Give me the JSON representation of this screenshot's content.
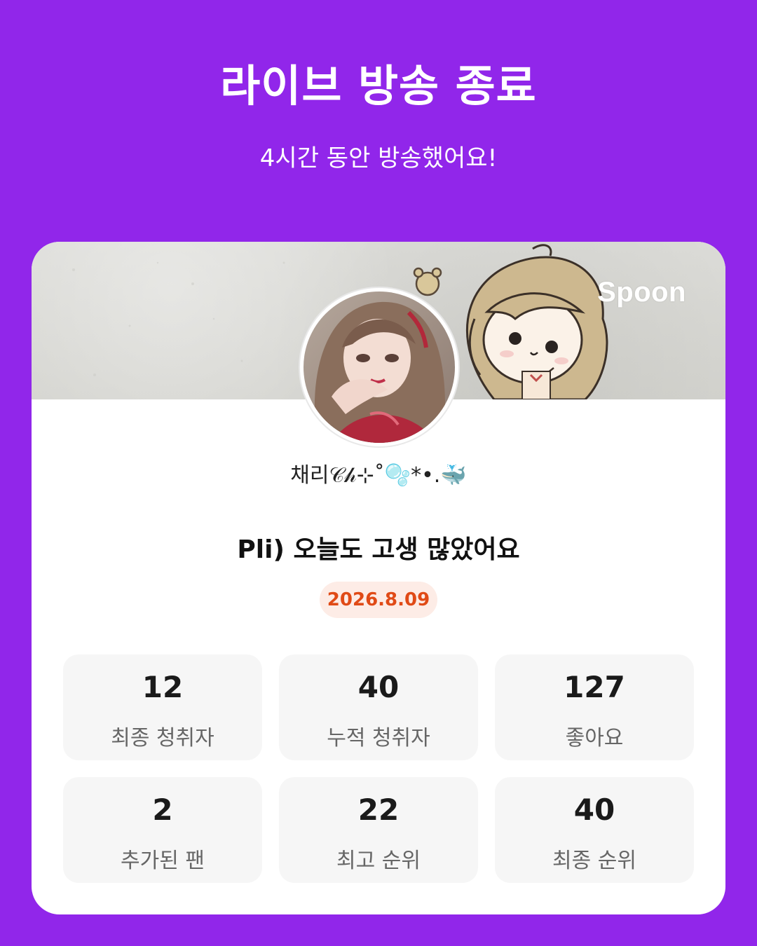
{
  "header": {
    "title": "라이브 방송 종료",
    "subtitle": "4시간 동안 방송했어요!"
  },
  "card": {
    "brand": "Spoon",
    "username": "채리𝒞𝒽⊹˚🫧*•.🐳",
    "broadcast_title": "Pli) 오늘도 고생 많았어요",
    "date": "2026.8.09"
  },
  "stats": [
    {
      "value": "12",
      "label": "최종 청취자"
    },
    {
      "value": "40",
      "label": "누적 청취자"
    },
    {
      "value": "127",
      "label": "좋아요"
    },
    {
      "value": "2",
      "label": "추가된 팬"
    },
    {
      "value": "22",
      "label": "최고 순위"
    },
    {
      "value": "40",
      "label": "최종 순위"
    }
  ],
  "colors": {
    "background": "#9126ea",
    "card": "#ffffff",
    "date_badge_bg": "#fdece6",
    "date_badge_text": "#e04a16",
    "stat_bg": "#f6f6f6"
  }
}
